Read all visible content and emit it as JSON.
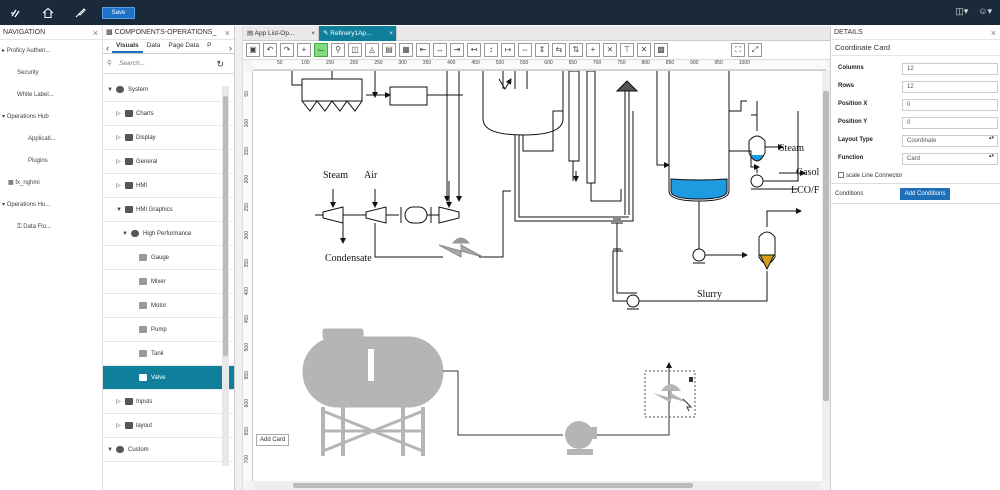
{
  "topbar": {
    "save_label": "Save"
  },
  "navigation": {
    "title": "NAVIGATION",
    "items": [
      {
        "label": "Proficy Authen..."
      },
      {
        "label": "Security"
      },
      {
        "label": "White Label..."
      },
      {
        "label": "Operations Hub"
      },
      {
        "label": "Applicati..."
      },
      {
        "label": "Plugins"
      },
      {
        "label": "fx_nghmi"
      },
      {
        "label": "Operations Hu..."
      },
      {
        "label": "Data Flo..."
      }
    ]
  },
  "components": {
    "title": "COMPONENTS-OPERATIONS_",
    "tabs": [
      {
        "label": "Visuals"
      },
      {
        "label": "Data"
      },
      {
        "label": "Page Data"
      },
      {
        "label": "P"
      }
    ],
    "search_placeholder": "Search...",
    "tree": [
      {
        "label": "System"
      },
      {
        "label": "Charts"
      },
      {
        "label": "Display"
      },
      {
        "label": "General"
      },
      {
        "label": "HMI"
      },
      {
        "label": "HMI Graphics"
      },
      {
        "label": "High Performance"
      },
      {
        "label": "Gauge"
      },
      {
        "label": "Mixer"
      },
      {
        "label": "Motor"
      },
      {
        "label": "Pump"
      },
      {
        "label": "Tank"
      },
      {
        "label": "Valve"
      },
      {
        "label": "Inputs"
      },
      {
        "label": "layout"
      },
      {
        "label": "Custom"
      }
    ]
  },
  "doc_tabs": [
    {
      "label": "App List-Op..."
    },
    {
      "label": "Refinery1Ap..."
    }
  ],
  "ruler_h": [
    "50",
    "100",
    "150",
    "200",
    "250",
    "300",
    "350",
    "400",
    "450",
    "500",
    "550",
    "600",
    "650",
    "700",
    "750",
    "800",
    "850",
    "900",
    "950",
    "1000"
  ],
  "ruler_v": [
    "50",
    "100",
    "150",
    "200",
    "250",
    "300",
    "350",
    "400",
    "450",
    "500",
    "550",
    "600",
    "650",
    "700"
  ],
  "canvas": {
    "labels": {
      "steam1": "Steam",
      "air": "Air",
      "condensate": "Condensate",
      "steam2": "Steam",
      "gasol": "Gasol",
      "lcof": "LCO/F",
      "slurry": "Slurry"
    },
    "add_card": "Add Card"
  },
  "details": {
    "title": "DETAILS",
    "subtitle": "Coordinate Card",
    "props": [
      {
        "label": "Columns",
        "value": "12"
      },
      {
        "label": "Rows",
        "value": "12"
      },
      {
        "label": "Position X",
        "value": "0"
      },
      {
        "label": "Position Y",
        "value": "0"
      },
      {
        "label": "Layout Type",
        "value": "Coordinate"
      },
      {
        "label": "Function",
        "value": "Card"
      }
    ],
    "scale_line": "scale Line Connector",
    "conditions_label": "Conditions",
    "add_conditions": "Add Conditions"
  },
  "colors": {
    "topbar": "#1b2a3a",
    "accent": "#0f7f9c",
    "button": "#1e73c8",
    "liquid": "#1e9be0",
    "sediment": "#d4a017"
  }
}
